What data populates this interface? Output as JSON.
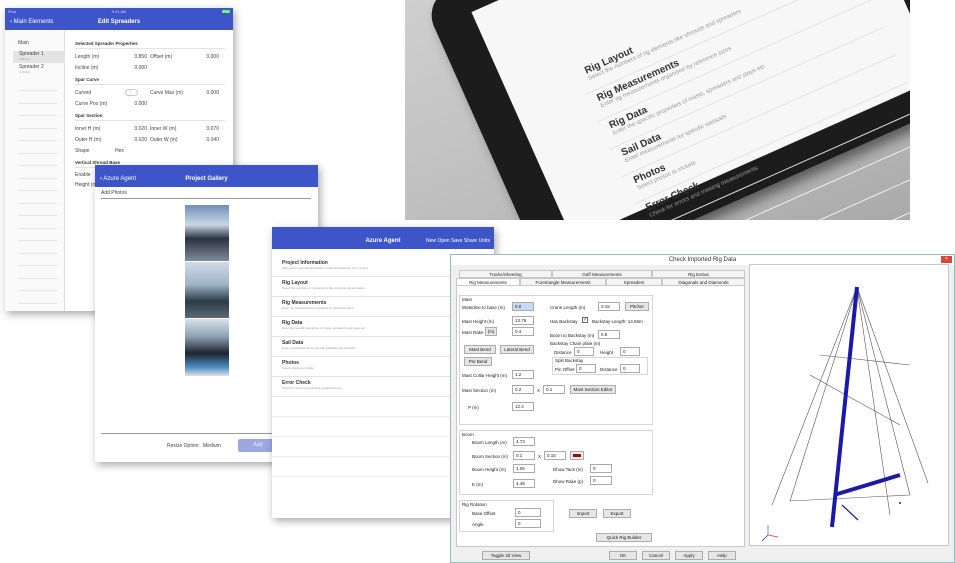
{
  "spreaders": {
    "status_left": "iPad",
    "status_right": "9:41 AM",
    "back_label": "Main Elements",
    "title": "Edit Spreaders",
    "side_header": "Main",
    "side_items": [
      {
        "label": "Spreader 1",
        "sub": "1.50 (m)"
      },
      {
        "label": "Spreader 2",
        "sub": "0.70 (m)"
      }
    ],
    "sec_selected": "Selected Spreader Properties",
    "length_label": "Length (m)",
    "length_value": "0.850",
    "offset_label": "Offset (m)",
    "offset_value": "0.000",
    "incline_label": "Incline (m)",
    "incline_value": "0.000",
    "sec_curve": "Spar Curve",
    "curved_label": "Curved",
    "curvemax_label": "Curve Max (m)",
    "curvemax_value": "0.000",
    "curvepos_label": "Curve Pos (m)",
    "curvepos_value": "0.000",
    "sec_section": "Spar Section",
    "innerh_label": "Inner H (m)",
    "innerh_value": "0.020",
    "innerw_label": "Inner W (m)",
    "innerw_value": "0.070",
    "outerh_label": "Outer H (m)",
    "outerh_value": "0.020",
    "outerw_label": "Outer W (m)",
    "outerw_value": "0.040",
    "shape_label": "Shape",
    "shape_value": "Hex",
    "sec_vertical": "Vertical Shroud Base",
    "enable_label": "Enable",
    "height_label": "Height (m)"
  },
  "gallery": {
    "back_label": "Azure Agent",
    "title": "Project Gallery",
    "add_label": "Add Photos",
    "resize_label": "Resize Option:",
    "resize_value": "Medium",
    "action_label": "Add"
  },
  "agent": {
    "title": "Azure Agent",
    "actions": [
      "New",
      "Open",
      "Save",
      "Share",
      "Units"
    ],
    "menu": [
      {
        "title": "Project Information",
        "sub": "Store some general information, notes and dates for your project"
      },
      {
        "title": "Rig Layout",
        "sub": "Select the numbers of rig elements like shrouds and spreaders"
      },
      {
        "title": "Rig Measurements",
        "sub": "Enter rig measurements organised by reference sizes"
      },
      {
        "title": "Rig Data",
        "sub": "Enter the specific properties of masts, spreaders and stays etc"
      },
      {
        "title": "Sail Data",
        "sub": "Enter measurements for specific sail/sails and foresails"
      },
      {
        "title": "Photos",
        "sub": "Select photos to include"
      },
      {
        "title": "Error Check",
        "sub": "Check for errors and missing measurements"
      }
    ]
  },
  "tablet": {
    "menu": [
      {
        "title": "Rig Layout",
        "sub": "Select the numbers of rig elements like shrouds and spreaders"
      },
      {
        "title": "Rig Measurements",
        "sub": "Enter rig measurements organised by reference sizes"
      },
      {
        "title": "Rig Data",
        "sub": "Enter the specific properties of masts, spreaders and stays etc"
      },
      {
        "title": "Sail Data",
        "sub": "Enter measurements for specific sail/sails"
      },
      {
        "title": "Photos",
        "sub": "Select photos to include"
      },
      {
        "title": "Error Check",
        "sub": "Check for errors and missing measurements"
      }
    ]
  },
  "dialog": {
    "title": "Check Imported Rig Data",
    "close": "×",
    "tabs_top": [
      "Tracks/Sheeting",
      "Gaff Measurements",
      "Rig Extras"
    ],
    "tabs_bottom": [
      "Rig Measurements",
      "Foretriangle Measurements",
      "Spreaders",
      "Diagonals and Diamonds"
    ],
    "mast_group": "Mast",
    "waterline_label": "Waterline to base (m)",
    "waterline_value": "0.0",
    "crane_label": "Crane Length (m)",
    "crane_value": "0.15",
    "pitcher_btn": "Pitcher",
    "mast_height_label": "Mast Height (m)",
    "mast_height_value": "13.76",
    "has_backstay_label": "Has Backstay",
    "backstay_length": "Backstay Length: 13.69m",
    "mast_rake_label": "Mast Rake",
    "mast_rake_unit": "(m)",
    "mast_rake_value": "0.4",
    "boom_backstay_label": "Boom to Backstay (m)",
    "boom_backstay_value": "0.8",
    "chainplate_label": "Backstay Chain plate (m)",
    "distance_label": "Distance",
    "distance_value": "0",
    "height_label": "Height",
    "height_value": "0",
    "split_label": "Split Backstay",
    "pin_offset_label": "Pin Offset",
    "pin_offset_value": "0",
    "distance2_label": "Distance",
    "distance2_value": "0",
    "mast_bend_btn": "Mast Bend",
    "lateral_bend_btn": "Lateral Bend",
    "pre_bend_btn": "Pre Bend",
    "collar_label": "Mast Collar Height (m)",
    "collar_value": "1.2",
    "section_label": "Mast Section (m)",
    "section_a": "0.2",
    "section_x": "X",
    "section_b": "0.1",
    "section_editor_btn": "Mast Section Editor",
    "p_label": "P (m)",
    "p_value": "12.4",
    "boom_group": "Boom",
    "boom_length_label": "Boom Length (m)",
    "boom_length_value": "4.73",
    "boom_section_label": "Boom Section (m)",
    "boom_section_a": "0.1",
    "boom_section_x": "X",
    "boom_section_b": "0.15",
    "boom_height_label": "Boom Height (m)",
    "boom_height_value": "1.06",
    "dhow_tack_label": "Dhow Tack (m)",
    "dhow_tack_value": "0",
    "e_label": "E (m)",
    "e_value": "4.49",
    "dhow_rake_label": "Dhow Rake (p)",
    "dhow_rake_value": "0",
    "rotation_group": "Rig Rotation",
    "base_offset_label": "Base Offset",
    "base_offset_value": "0",
    "angle_label": "Angle",
    "angle_value": "0",
    "import_btn": "Import",
    "export_btn": "Export",
    "quick_btn": "Quick Rig Builder",
    "toggle_btn": "Toggle 3d View",
    "ok_btn": "OK",
    "cancel_btn": "Cancel",
    "apply_btn": "Apply",
    "help_btn": "Help",
    "colors": {
      "boom_swatch": "#9b0d0d",
      "rig_blue": "#1a1aa8"
    }
  }
}
